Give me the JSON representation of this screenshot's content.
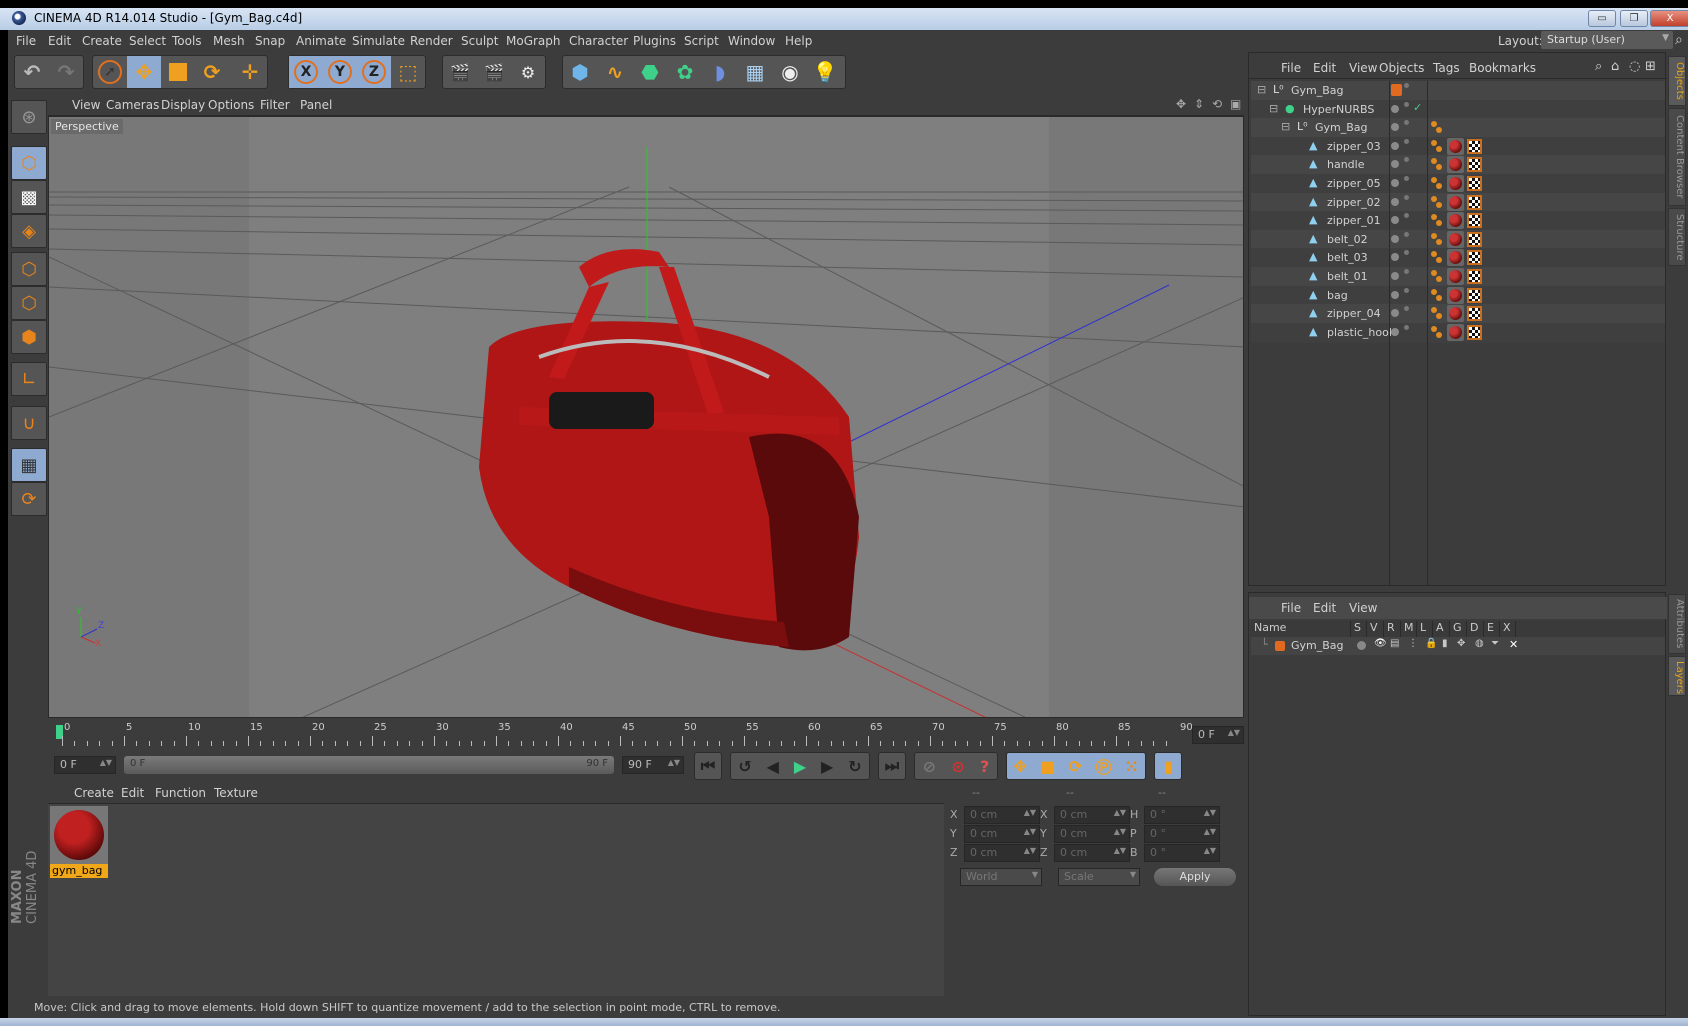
{
  "window": {
    "title": "CINEMA 4D R14.014 Studio - [Gym_Bag.c4d]",
    "controls": {
      "minimize": "▭",
      "restore": "❐",
      "close": "X"
    }
  },
  "menubar": {
    "items": [
      "File",
      "Edit",
      "Create",
      "Select",
      "Tools",
      "Mesh",
      "Snap",
      "Animate",
      "Simulate",
      "Render",
      "Sculpt",
      "MoGraph",
      "Character",
      "Plugins",
      "Script",
      "Window",
      "Help"
    ],
    "layout_label": "Layout:",
    "layout_value": "Startup (User)"
  },
  "toolbar": {
    "undo": "undo-icon",
    "redo": "redo-icon",
    "tools": [
      "live-selection",
      "move",
      "scale",
      "rotate",
      "last-tool"
    ],
    "axis": [
      "X",
      "Y",
      "Z"
    ],
    "coord_system": "world-coordinates",
    "render": [
      "render-view",
      "render-to-picture-viewer",
      "render-settings"
    ],
    "objects": [
      "cube",
      "spline-pen",
      "nurbs",
      "array",
      "deformer",
      "scene-floor",
      "camera",
      "light"
    ]
  },
  "left_toolbar": [
    "make-editable",
    "model-mode",
    "texture-mode",
    "workplane-mode",
    "points-mode",
    "edges-mode",
    "polygons-mode",
    "axis-mode",
    "snap-magnet",
    "locked-workplane",
    "planar-workplane"
  ],
  "viewport": {
    "menu": [
      "View",
      "Cameras",
      "Display",
      "Options",
      "Filter",
      "Panel"
    ],
    "camera_label": "Perspective",
    "nav_icons": [
      "move-view",
      "dolly-view",
      "rotate-view",
      "maximize-view"
    ],
    "axis_labels": {
      "y": "Y",
      "z": "Z",
      "x": "X"
    }
  },
  "timeline": {
    "ticks": [
      "0",
      "5",
      "10",
      "15",
      "20",
      "25",
      "30",
      "35",
      "40",
      "45",
      "50",
      "55",
      "60",
      "65",
      "70",
      "75",
      "80",
      "85",
      "90"
    ],
    "current_frame": "0 F",
    "start_field": "0 F",
    "range_start": "0 F",
    "range_end": "90 F",
    "end_field": "90 F"
  },
  "transport": {
    "buttons": [
      "go-to-start",
      "previous-key",
      "previous-frame",
      "play",
      "next-frame",
      "next-key",
      "go-to-end",
      "record-keys",
      "autokeying",
      "keyframe-selection",
      "record-position",
      "record-scale",
      "record-rotation",
      "record-parameter",
      "record-pla",
      "timeline-window"
    ]
  },
  "materials": {
    "menu": [
      "Create",
      "Edit",
      "Function",
      "Texture"
    ],
    "items": [
      {
        "name": "gym_bag"
      }
    ]
  },
  "coordinates": {
    "header": [
      "--",
      "--",
      "--"
    ],
    "rows": [
      {
        "l1": "X",
        "v1": "0 cm",
        "l2": "X",
        "v2": "0 cm",
        "l3": "H",
        "v3": "0 °"
      },
      {
        "l1": "Y",
        "v1": "0 cm",
        "l2": "Y",
        "v2": "0 cm",
        "l3": "P",
        "v3": "0 °"
      },
      {
        "l1": "Z",
        "v1": "0 cm",
        "l2": "Z",
        "v2": "0 cm",
        "l3": "B",
        "v3": "0 °"
      }
    ],
    "mode_select": "World",
    "type_select": "Scale",
    "apply_label": "Apply"
  },
  "object_manager": {
    "menu": [
      "File",
      "Edit",
      "View",
      "Objects",
      "Tags",
      "Bookmarks"
    ],
    "objects": [
      {
        "name": "Gym_Bag",
        "type": "null",
        "level": 0,
        "tags": false
      },
      {
        "name": "HyperNURBS",
        "type": "hypernurbs",
        "level": 1,
        "tags": false,
        "enabled": "✓"
      },
      {
        "name": "Gym_Bag",
        "type": "null",
        "level": 2,
        "tags": "phong"
      },
      {
        "name": "zipper_03",
        "type": "polygon",
        "level": 3,
        "tags": true
      },
      {
        "name": "handle",
        "type": "polygon",
        "level": 3,
        "tags": true
      },
      {
        "name": "zipper_05",
        "type": "polygon",
        "level": 3,
        "tags": true
      },
      {
        "name": "zipper_02",
        "type": "polygon",
        "level": 3,
        "tags": true
      },
      {
        "name": "zipper_01",
        "type": "polygon",
        "level": 3,
        "tags": true
      },
      {
        "name": "belt_02",
        "type": "polygon",
        "level": 3,
        "tags": true
      },
      {
        "name": "belt_03",
        "type": "polygon",
        "level": 3,
        "tags": true
      },
      {
        "name": "belt_01",
        "type": "polygon",
        "level": 3,
        "tags": true
      },
      {
        "name": "bag",
        "type": "polygon",
        "level": 3,
        "tags": true
      },
      {
        "name": "zipper_04",
        "type": "polygon",
        "level": 3,
        "tags": true
      },
      {
        "name": "plastic_hook",
        "type": "polygon",
        "level": 3,
        "tags": true
      }
    ]
  },
  "side_tabs_top": [
    "Objects",
    "Content Browser",
    "Structure"
  ],
  "side_tabs_bottom": [
    "Attributes",
    "Layers"
  ],
  "layer_manager": {
    "menu": [
      "File",
      "Edit",
      "View"
    ],
    "columns": [
      "Name",
      "S",
      "V",
      "R",
      "M",
      "L",
      "A",
      "G",
      "D",
      "E",
      "X"
    ],
    "layers": [
      {
        "name": "Gym_Bag",
        "color": "#e06a20"
      }
    ]
  },
  "status": "Move: Click and drag to move elements. Hold down SHIFT to quantize movement / add to the selection in point mode, CTRL to remove.",
  "branding": {
    "maxon": "MAXON",
    "product": "CINEMA 4D"
  },
  "colors": {
    "accent": "#e8841c",
    "selected": "#8faad0",
    "layer": "#e06a20",
    "material_label": "#f0a818",
    "bag": "#b51616"
  }
}
